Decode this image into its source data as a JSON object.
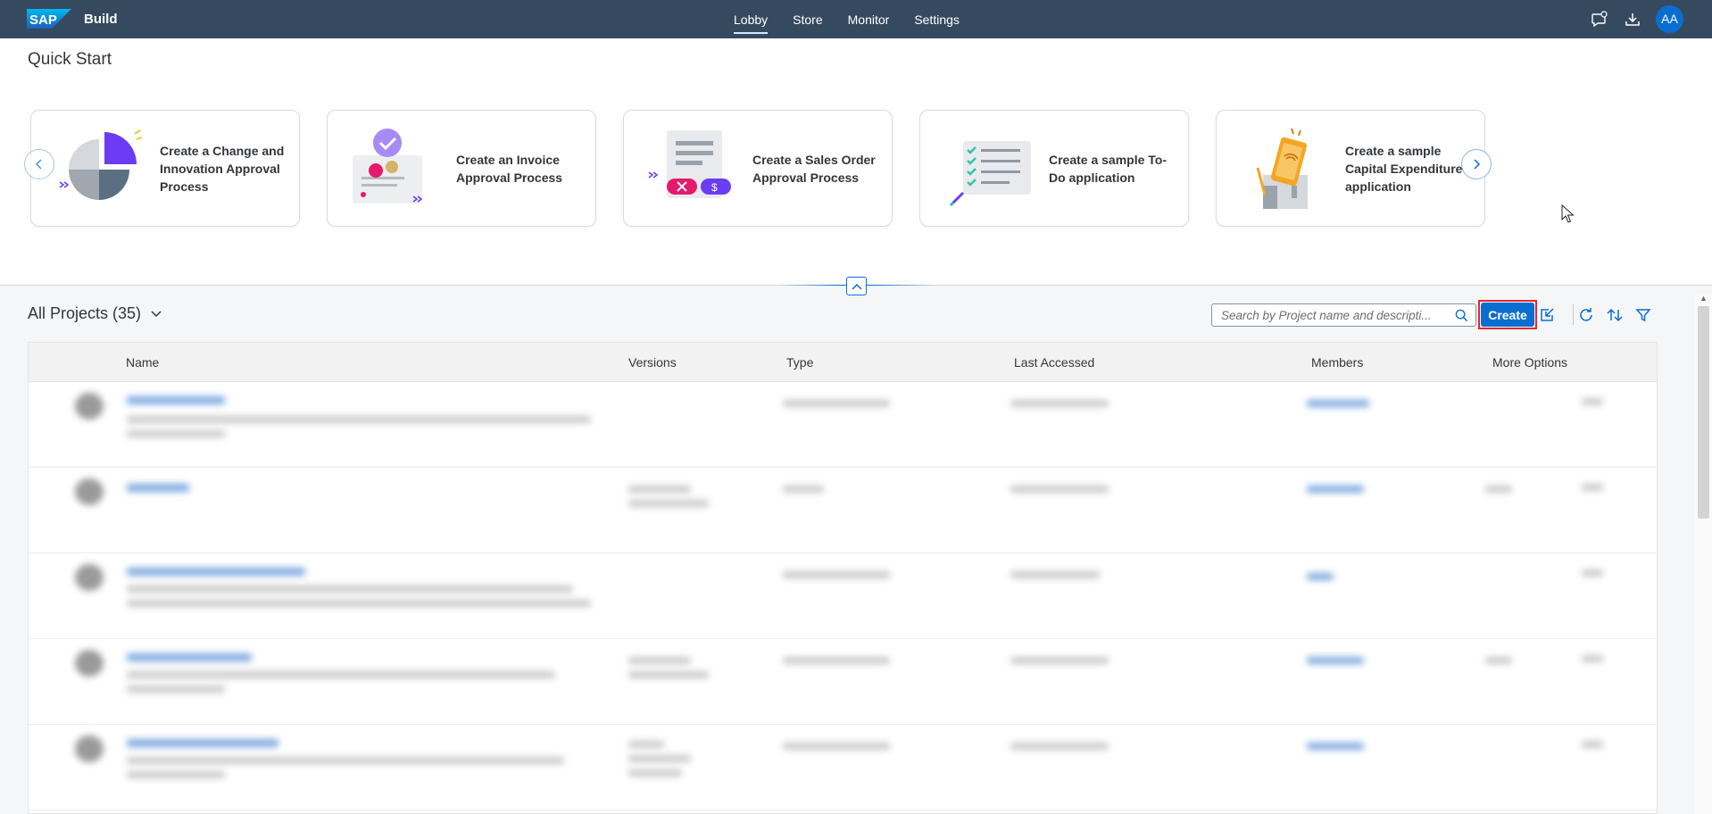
{
  "app": {
    "brand": "SAP",
    "product": "Build"
  },
  "nav": {
    "items": [
      "Lobby",
      "Store",
      "Monitor",
      "Settings"
    ],
    "active": "Lobby"
  },
  "user": {
    "initials": "AA"
  },
  "quick_start": {
    "title": "Quick Start",
    "cards": [
      {
        "label": "Create a Change and Innovation Approval Process"
      },
      {
        "label": "Create an Invoice Approval Process"
      },
      {
        "label": "Create a Sales Order Approval Process"
      },
      {
        "label": "Create a sample To-Do application"
      },
      {
        "label": "Create a sample Capital Expenditure application"
      }
    ]
  },
  "projects": {
    "title": "All Projects (35)",
    "search_placeholder": "Search by Project name and descripti...",
    "create_label": "Create",
    "columns": [
      "Name",
      "Versions",
      "Type",
      "Last Accessed",
      "Members",
      "More Options"
    ]
  },
  "colors": {
    "shellbar": "#354a5f",
    "accent": "#0a6ed1",
    "highlight": "#e5272f"
  }
}
